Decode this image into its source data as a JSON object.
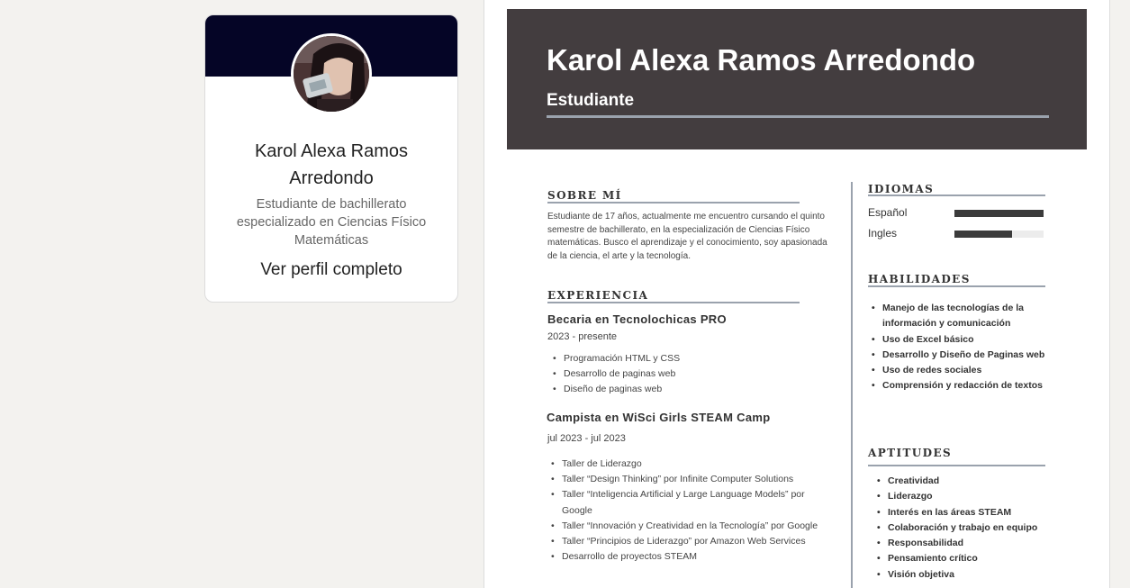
{
  "profile_card": {
    "name": "Karol Alexa Ramos Arredondo",
    "description": "Estudiante de bachillerato especializado en Ciencias Físico Matemáticas",
    "link_label": "Ver perfil completo",
    "banner_color": "#050526"
  },
  "resume": {
    "name": "Karol Alexa Ramos Arredondo",
    "role": "Estudiante",
    "about": {
      "title": "SOBRE MÍ",
      "text": "Estudiante de 17 años, actualmente me encuentro cursando el quinto semestre de bachillerato, en la especialización de Ciencias Físico matemáticas. Busco el aprendizaje y el conocimiento, soy apasionada de la ciencia, el arte y la tecnología."
    },
    "experience": {
      "title": "EXPERIENCIA",
      "jobs": [
        {
          "title": "Becaria en Tecnolochicas PRO",
          "date": "2023 - presente",
          "items": [
            "Programación HTML y CSS",
            "Desarrollo de paginas web",
            "Diseño de paginas web"
          ]
        },
        {
          "title": "Campista en WiSci Girls STEAM Camp",
          "date": "jul 2023 - jul 2023",
          "items": [
            "Taller de Liderazgo",
            "Taller “Design Thinking” por Infinite Computer Solutions",
            "Taller “Inteligencia Artificial y Large Language Models” por Google",
            "Taller “Innovación y Creatividad en la Tecnología” por Google",
            "Taller “Principios de Liderazgo” por Amazon Web Services",
            "Desarrollo de proyectos STEAM"
          ]
        }
      ]
    },
    "languages": {
      "title": "IDIOMAS",
      "items": [
        {
          "label": "Español",
          "level": 1.0
        },
        {
          "label": "Ingles",
          "level": 0.65
        }
      ]
    },
    "skills": {
      "title": "HABILIDADES",
      "items": [
        "Manejo de las tecnologías de la información y comunicación",
        "Uso de Excel básico",
        "Desarrollo y Diseño de Paginas web",
        "Uso de redes sociales",
        "Comprensión y redacción de textos"
      ]
    },
    "aptitudes": {
      "title": "APTITUDES",
      "items": [
        "Creatividad",
        "Liderazgo",
        "Interés en las áreas STEAM",
        "Colaboración y trabajo en equipo",
        "Responsabilidad",
        "Pensamiento crítico",
        "Visión objetiva"
      ]
    },
    "header_color": "#433d3f",
    "accent_rule_color": "#9aa2ad"
  }
}
